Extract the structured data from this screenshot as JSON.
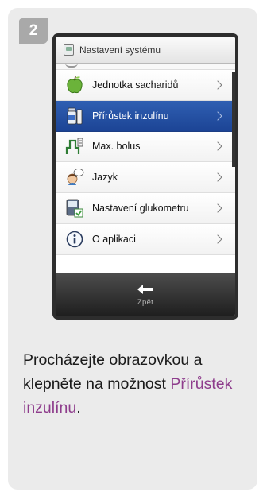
{
  "step": {
    "number": "2"
  },
  "screen": {
    "title": "Nastavení systému",
    "menu": [
      {
        "label": "Jednotka sacharidů",
        "icon": "apple-icon"
      },
      {
        "label": "Přírůstek inzulínu",
        "icon": "insulin-vial-icon",
        "selected": true
      },
      {
        "label": "Max. bolus",
        "icon": "max-bolus-icon"
      },
      {
        "label": "Jazyk",
        "icon": "language-icon"
      },
      {
        "label": "Nastavení glukometru",
        "icon": "meter-settings-icon"
      },
      {
        "label": "O aplikaci",
        "icon": "info-icon"
      }
    ],
    "back": {
      "label": "Zpět",
      "icon": "back-arrow-icon"
    }
  },
  "instruction": {
    "text_before": "Procházejte obrazovkou a klepněte na možnost ",
    "highlight": "Přírůstek inzulínu",
    "text_after": "."
  },
  "colors": {
    "selected_row": "#1c4495",
    "highlight_text": "#8e3d8c",
    "card_background": "#ebebeb"
  }
}
